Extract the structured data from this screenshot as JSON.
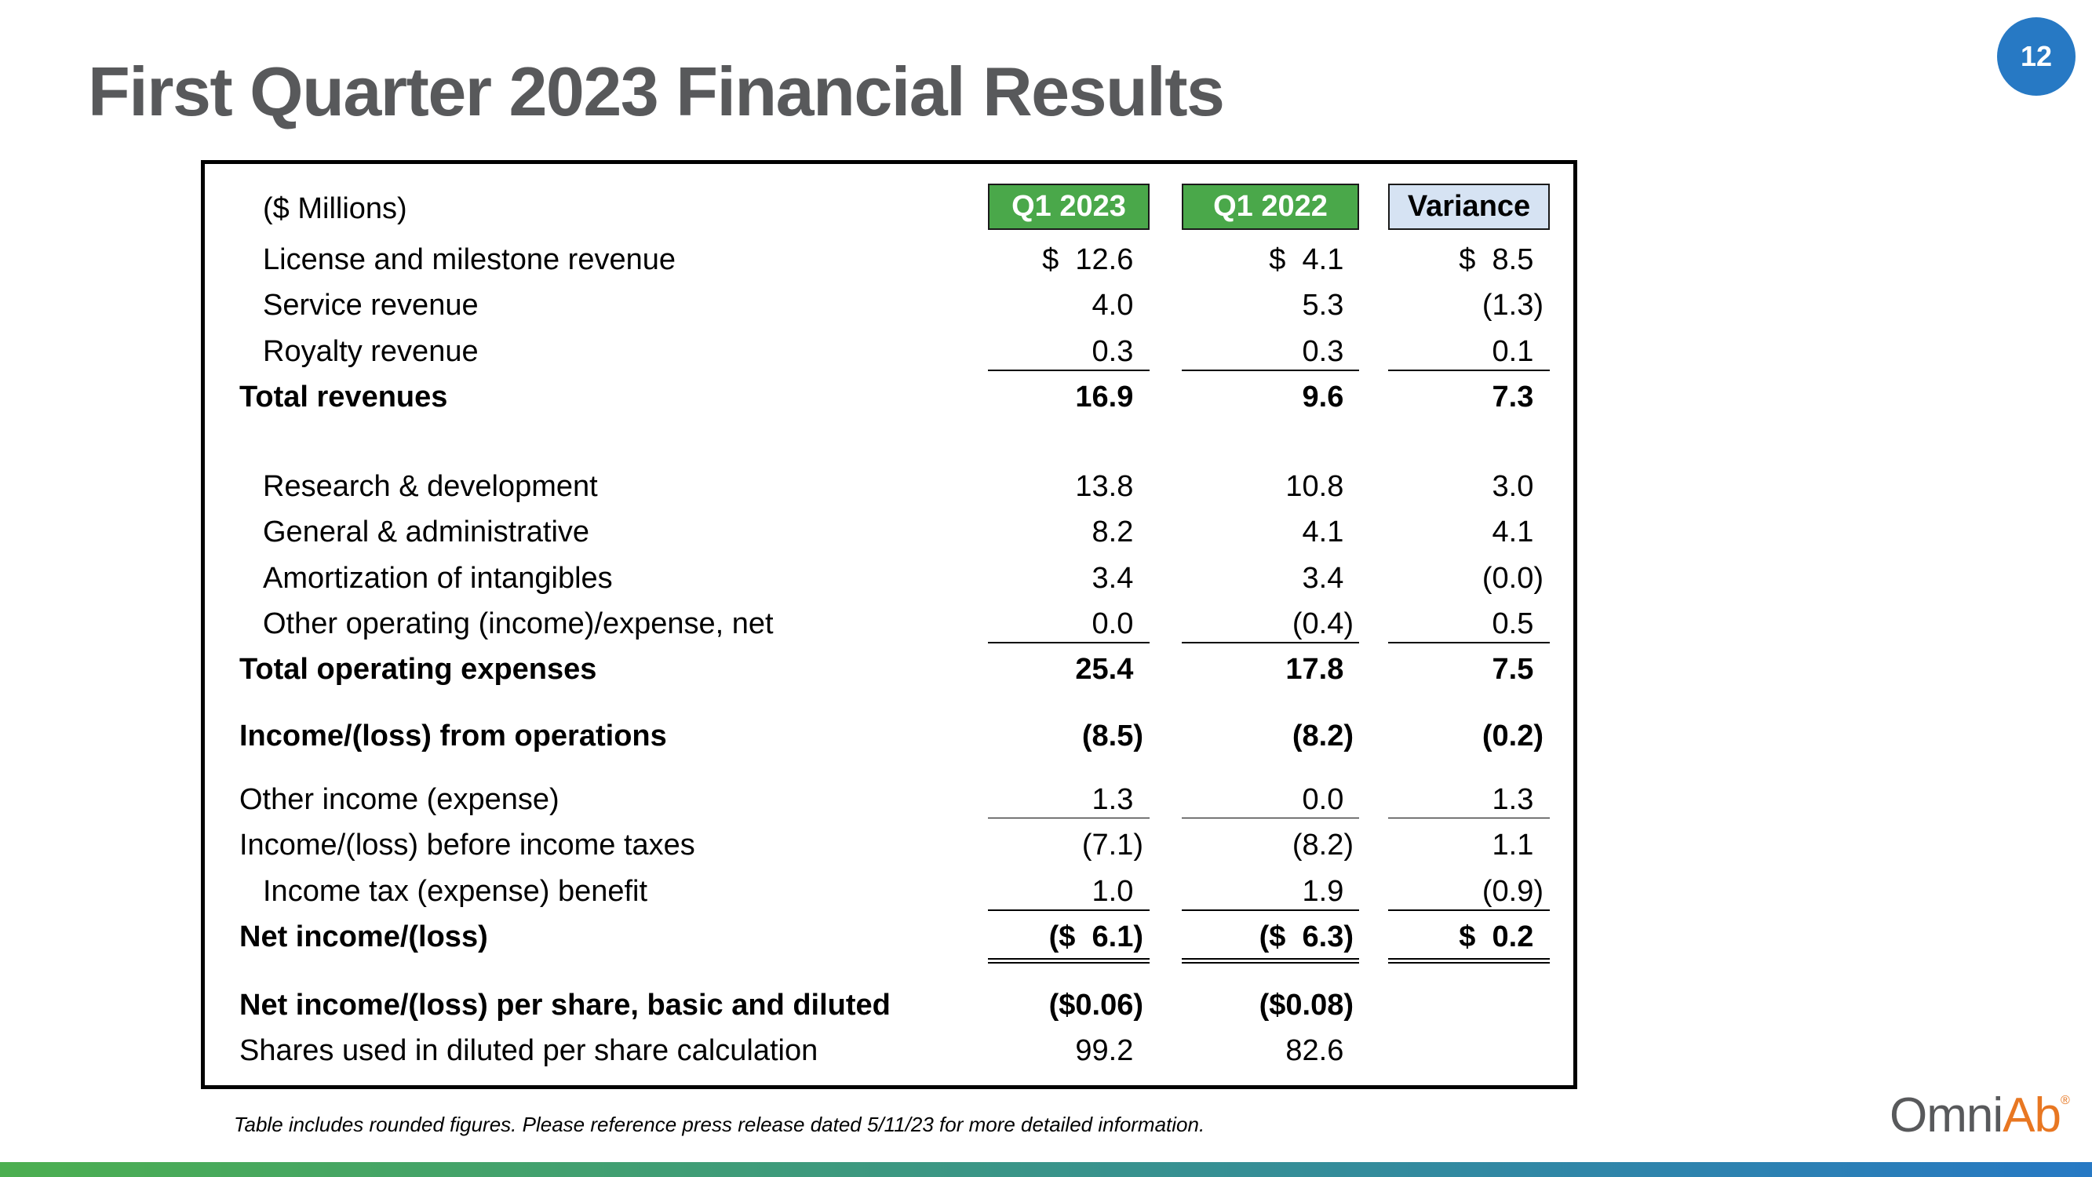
{
  "title": "First Quarter 2023 Financial Results",
  "page_number": "12",
  "colors": {
    "title": "#58595b",
    "badge": "#2779c4",
    "header_green": "#4aa84a",
    "header_variance": "#d6e3f3",
    "bar_start": "#4caf50",
    "bar_end": "#2779c4",
    "logo_gray": "#58595b",
    "logo_orange": "#e87722"
  },
  "table": {
    "units_label": "($ Millions)",
    "columns": [
      {
        "label": "Q1 2023",
        "style": "green"
      },
      {
        "label": "Q1 2022",
        "style": "green"
      },
      {
        "label": "Variance",
        "style": "blue"
      }
    ],
    "rows": [
      {
        "label": "License and milestone revenue",
        "indent": true,
        "bold": false,
        "values": [
          "$  12.6",
          "$  4.1",
          "$  8.5"
        ]
      },
      {
        "label": "Service revenue",
        "indent": true,
        "bold": false,
        "values": [
          "4.0",
          "5.3",
          "(1.3)"
        ]
      },
      {
        "label": "Royalty revenue",
        "indent": true,
        "bold": false,
        "values": [
          "0.3",
          "0.3",
          "0.1"
        ],
        "rule_below": "single"
      },
      {
        "label": "Total revenues",
        "indent": false,
        "bold": true,
        "values": [
          "16.9",
          "9.6",
          "7.3"
        ]
      },
      {
        "label": "Research & development",
        "indent": true,
        "bold": false,
        "values": [
          "13.8",
          "10.8",
          "3.0"
        ]
      },
      {
        "label": "General & administrative",
        "indent": true,
        "bold": false,
        "values": [
          "8.2",
          "4.1",
          "4.1"
        ]
      },
      {
        "label": "Amortization of intangibles",
        "indent": true,
        "bold": false,
        "values": [
          "3.4",
          "3.4",
          "(0.0)"
        ]
      },
      {
        "label": "Other operating (income)/expense, net",
        "indent": true,
        "bold": false,
        "values": [
          "0.0",
          "(0.4)",
          "0.5"
        ],
        "rule_below": "single"
      },
      {
        "label": "Total operating expenses",
        "indent": false,
        "bold": true,
        "values": [
          "25.4",
          "17.8",
          "7.5"
        ]
      },
      {
        "label": "Income/(loss) from operations",
        "indent": false,
        "bold": true,
        "values": [
          "(8.5)",
          "(8.2)",
          "(0.2)"
        ]
      },
      {
        "label": "Other income (expense)",
        "indent": false,
        "bold": false,
        "values": [
          "1.3",
          "0.0",
          "1.3"
        ],
        "rule_below": "thin"
      },
      {
        "label": "Income/(loss) before income taxes",
        "indent": false,
        "bold": false,
        "values": [
          "(7.1)",
          "(8.2)",
          "1.1"
        ]
      },
      {
        "label": "Income tax (expense) benefit",
        "indent": true,
        "bold": false,
        "values": [
          "1.0",
          "1.9",
          "(0.9)"
        ],
        "rule_below": "single"
      },
      {
        "label": "Net income/(loss)",
        "indent": false,
        "bold": true,
        "values": [
          "($  6.1)",
          "($  6.3)",
          "$  0.2"
        ],
        "rule_below": "double"
      },
      {
        "label": "Net income/(loss) per share, basic and diluted",
        "indent": false,
        "bold": true,
        "values": [
          "($0.06)",
          "($0.08)",
          ""
        ]
      },
      {
        "label": "Shares used in diluted per share calculation",
        "indent": false,
        "bold": false,
        "values": [
          "99.2",
          "82.6",
          ""
        ]
      }
    ]
  },
  "footnote": "Table includes rounded figures.  Please reference press release dated 5/11/23 for more detailed information.",
  "logo": {
    "part1": "Omni",
    "part2": "Ab",
    "mark": "®"
  }
}
